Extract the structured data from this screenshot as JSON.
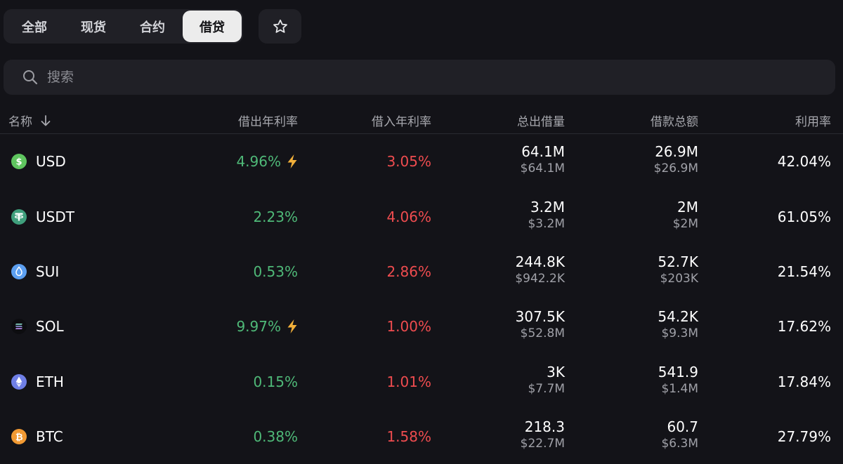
{
  "tabs": [
    {
      "label": "全部",
      "active": false
    },
    {
      "label": "现货",
      "active": false
    },
    {
      "label": "合约",
      "active": false
    },
    {
      "label": "借贷",
      "active": true
    }
  ],
  "favorite_icon": "star-icon",
  "search": {
    "placeholder": "搜索",
    "value": "",
    "icon": "search-icon"
  },
  "table": {
    "headers": {
      "name": "名称",
      "lend_apr": "借出年利率",
      "borrow_apr": "借入年利率",
      "total_supply": "总出借量",
      "total_borrow": "借款总额",
      "utilization": "利用率"
    },
    "sort_icon": "arrow-down-icon",
    "rows": [
      {
        "symbol": "USD",
        "icon": "usd-coin-icon",
        "icon_color": "#5fc55f",
        "lend_apr": "4.96%",
        "boost": true,
        "borrow_apr": "3.05%",
        "supply": "64.1M",
        "supply_usd": "$64.1M",
        "borrow": "26.9M",
        "borrow_usd": "$26.9M",
        "utilization": "42.04%"
      },
      {
        "symbol": "USDT",
        "icon": "usdt-coin-icon",
        "icon_color": "#3f9f7c",
        "lend_apr": "2.23%",
        "boost": false,
        "borrow_apr": "4.06%",
        "supply": "3.2M",
        "supply_usd": "$3.2M",
        "borrow": "2M",
        "borrow_usd": "$2M",
        "utilization": "61.05%"
      },
      {
        "symbol": "SUI",
        "icon": "sui-coin-icon",
        "icon_color": "#5c9ff0",
        "lend_apr": "0.53%",
        "boost": false,
        "borrow_apr": "2.86%",
        "supply": "244.8K",
        "supply_usd": "$942.2K",
        "borrow": "52.7K",
        "borrow_usd": "$203K",
        "utilization": "21.54%"
      },
      {
        "symbol": "SOL",
        "icon": "sol-coin-icon",
        "icon_color": "#0d0d10",
        "lend_apr": "9.97%",
        "boost": true,
        "borrow_apr": "1.00%",
        "supply": "307.5K",
        "supply_usd": "$52.8M",
        "borrow": "54.2K",
        "borrow_usd": "$9.3M",
        "utilization": "17.62%"
      },
      {
        "symbol": "ETH",
        "icon": "eth-coin-icon",
        "icon_color": "#6f7fe6",
        "lend_apr": "0.15%",
        "boost": false,
        "borrow_apr": "1.01%",
        "supply": "3K",
        "supply_usd": "$7.7M",
        "borrow": "541.9",
        "borrow_usd": "$1.4M",
        "utilization": "17.84%"
      },
      {
        "symbol": "BTC",
        "icon": "btc-coin-icon",
        "icon_color": "#f29a33",
        "lend_apr": "0.38%",
        "boost": false,
        "borrow_apr": "1.58%",
        "supply": "218.3",
        "supply_usd": "$22.7M",
        "borrow": "60.7",
        "borrow_usd": "$6.3M",
        "utilization": "27.79%"
      }
    ]
  },
  "colors": {
    "background": "#131318",
    "panel": "#202026",
    "positive": "#4fb978",
    "negative": "#ef4c4f",
    "boost": "#f2b03a",
    "muted": "#a0a1a8"
  }
}
